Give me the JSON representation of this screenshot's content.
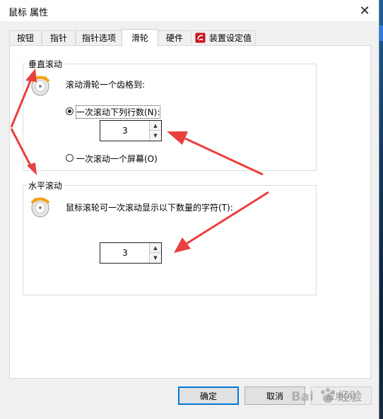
{
  "window": {
    "title": "鼠标 属性",
    "close_glyph": "✕"
  },
  "tabs": [
    {
      "label": "按钮"
    },
    {
      "label": "指针"
    },
    {
      "label": "指针选项"
    },
    {
      "label": "滑轮"
    },
    {
      "label": "硬件"
    },
    {
      "label": "装置设定值"
    }
  ],
  "vertical": {
    "group_label": "垂直滚动",
    "description": "滚动滑轮一个齿格到:",
    "option_lines": "一次滚动下列行数(N):",
    "lines_value": "3",
    "option_screen": "一次滚动一个屏幕(O)",
    "selected": "lines"
  },
  "horizontal": {
    "group_label": "水平滚动",
    "description": "鼠标滚轮可一次滚动显示以下数量的字符(T):",
    "chars_value": "3"
  },
  "buttons": {
    "ok": "确定",
    "cancel": "取消",
    "apply": "应用(A)"
  },
  "watermark": {
    "text": "Bai 经验"
  },
  "icons": {
    "wheel": "mouse-wheel-icon",
    "device": "synaptics-device-icon",
    "spin_up": "spin-up-icon",
    "spin_down": "spin-down-icon",
    "annotation": "red-arrow-annotation"
  },
  "colors": {
    "accent": "#0078d7",
    "annotation": "#e8403f",
    "panel": "#ffffff",
    "window": "#f0f0f0"
  }
}
